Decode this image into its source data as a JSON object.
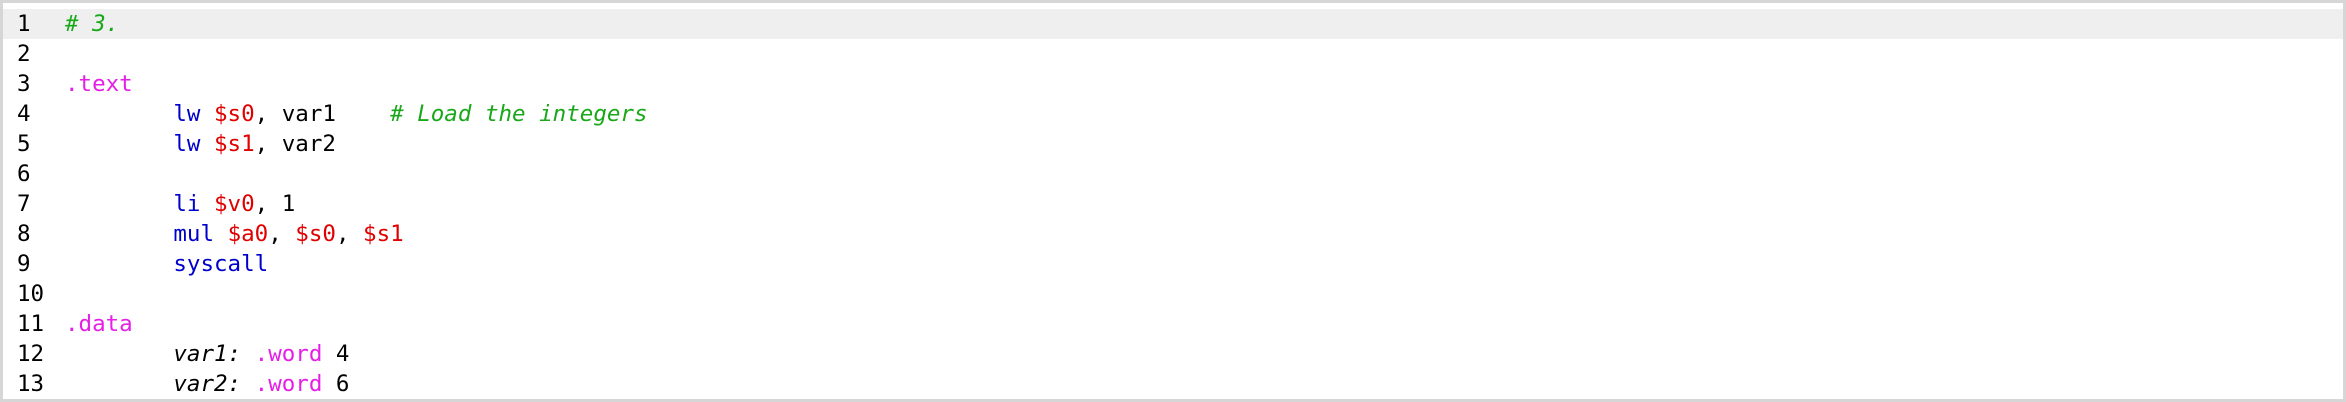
{
  "editor": {
    "lines": [
      {
        "number": "1",
        "tokens": [
          {
            "type": "comment",
            "text": "# 3."
          }
        ]
      },
      {
        "number": "2",
        "tokens": []
      },
      {
        "number": "3",
        "tokens": [
          {
            "type": "directive",
            "text": ".text"
          }
        ]
      },
      {
        "number": "4",
        "tokens": [
          {
            "type": "plain",
            "text": "        "
          },
          {
            "type": "instr",
            "text": "lw"
          },
          {
            "type": "plain",
            "text": " "
          },
          {
            "type": "reg",
            "text": "$s0"
          },
          {
            "type": "plain",
            "text": ", var1    "
          },
          {
            "type": "comment",
            "text": "# Load the integers"
          }
        ]
      },
      {
        "number": "5",
        "tokens": [
          {
            "type": "plain",
            "text": "        "
          },
          {
            "type": "instr",
            "text": "lw"
          },
          {
            "type": "plain",
            "text": " "
          },
          {
            "type": "reg",
            "text": "$s1"
          },
          {
            "type": "plain",
            "text": ", var2"
          }
        ]
      },
      {
        "number": "6",
        "tokens": []
      },
      {
        "number": "7",
        "tokens": [
          {
            "type": "plain",
            "text": "        "
          },
          {
            "type": "instr",
            "text": "li"
          },
          {
            "type": "plain",
            "text": " "
          },
          {
            "type": "reg",
            "text": "$v0"
          },
          {
            "type": "plain",
            "text": ", 1"
          }
        ]
      },
      {
        "number": "8",
        "tokens": [
          {
            "type": "plain",
            "text": "        "
          },
          {
            "type": "instr",
            "text": "mul"
          },
          {
            "type": "plain",
            "text": " "
          },
          {
            "type": "reg",
            "text": "$a0"
          },
          {
            "type": "plain",
            "text": ", "
          },
          {
            "type": "reg",
            "text": "$s0"
          },
          {
            "type": "plain",
            "text": ", "
          },
          {
            "type": "reg",
            "text": "$s1"
          }
        ]
      },
      {
        "number": "9",
        "tokens": [
          {
            "type": "plain",
            "text": "        "
          },
          {
            "type": "instr",
            "text": "syscall"
          }
        ]
      },
      {
        "number": "10",
        "tokens": []
      },
      {
        "number": "11",
        "tokens": [
          {
            "type": "directive",
            "text": ".data"
          }
        ]
      },
      {
        "number": "12",
        "tokens": [
          {
            "type": "plain",
            "text": "        "
          },
          {
            "type": "label",
            "text": "var1:"
          },
          {
            "type": "plain",
            "text": " "
          },
          {
            "type": "directive",
            "text": ".word"
          },
          {
            "type": "plain",
            "text": " 4"
          }
        ]
      },
      {
        "number": "13",
        "tokens": [
          {
            "type": "plain",
            "text": "        "
          },
          {
            "type": "label",
            "text": "var2:"
          },
          {
            "type": "plain",
            "text": " "
          },
          {
            "type": "directive",
            "text": ".word"
          },
          {
            "type": "plain",
            "text": " 6"
          }
        ]
      }
    ]
  },
  "colors": {
    "comment": "#1aa81a",
    "directive": "#e61ee6",
    "instruction": "#0000cc",
    "register": "#e00000",
    "current_line_highlight": "#efefef"
  }
}
